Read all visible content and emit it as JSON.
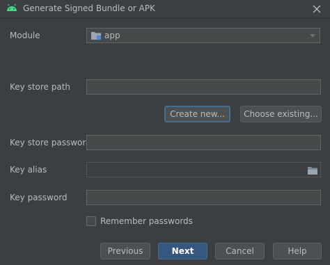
{
  "window": {
    "title": "Generate Signed Bundle or APK",
    "close_glyph": "✕"
  },
  "form": {
    "module_label": "Module",
    "module_value": "app",
    "keystore_path_label": "Key store path",
    "keystore_path_value": "",
    "create_new_label": "Create new...",
    "choose_existing_label": "Choose existing...",
    "keystore_password_label": "Key store password",
    "keystore_password_value": "",
    "key_alias_label": "Key alias",
    "key_alias_value": "",
    "key_password_label": "Key password",
    "key_password_value": "",
    "remember_label": "Remember passwords",
    "remember_checked": false
  },
  "footer": {
    "previous_label": "Previous",
    "next_label": "Next",
    "cancel_label": "Cancel",
    "help_label": "Help"
  },
  "icons": {
    "title": "android-icon",
    "module": "module-folder-icon",
    "browse": "folder-browse-icon",
    "dropdown": "chevron-down-icon"
  },
  "colors": {
    "background": "#3c3f41",
    "field_background": "#45494a",
    "primary_button": "#365880",
    "focus_border": "#466d94",
    "android_green": "#3ddc84",
    "text": "#bbbbbb"
  }
}
